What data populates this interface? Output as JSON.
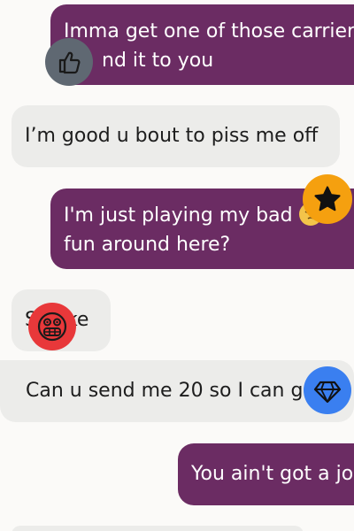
{
  "messages": [
    {
      "direction": "outgoing",
      "lines": [
        "Imma get one of those carrier",
        "nd it to you"
      ],
      "reaction": "thumbs-up"
    },
    {
      "direction": "incoming",
      "lines": [
        "I’m good u bout to piss me off"
      ]
    },
    {
      "direction": "outgoing",
      "lines": [
        "I'm just playing my bad",
        "fun around here?"
      ],
      "reaction": "star"
    },
    {
      "direction": "incoming",
      "lines": [
        "S",
        "ke"
      ],
      "reaction": "grimace"
    },
    {
      "direction": "incoming",
      "lines": [
        "Can u send me 20 so I can g"
      ],
      "reaction": "diamond"
    },
    {
      "direction": "outgoing",
      "lines": [
        "You ain't got a jo"
      ]
    }
  ],
  "colors": {
    "outgoing_bubble": "#6b2c63",
    "incoming_bubble": "#ececea",
    "thumbs_badge": "#5f6872",
    "star_badge": "#f5a00f",
    "grimace_badge": "#e8383a",
    "diamond_badge": "#3a7ff0"
  }
}
